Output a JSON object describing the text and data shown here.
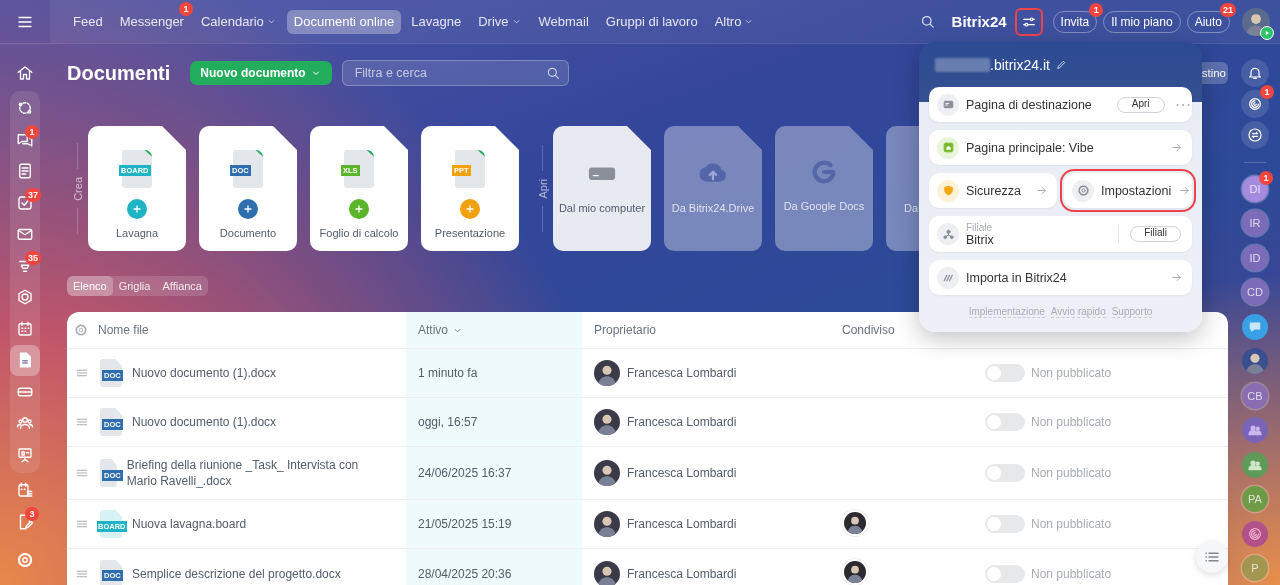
{
  "top_nav": {
    "menu_items": [
      {
        "label": "Feed",
        "selected": false,
        "dropdown": false
      },
      {
        "label": "Messenger",
        "selected": false,
        "dropdown": false,
        "badge": "1"
      },
      {
        "label": "Calendario",
        "selected": false,
        "dropdown": true
      },
      {
        "label": "Documenti online",
        "selected": true,
        "dropdown": false
      },
      {
        "label": "Lavagne",
        "selected": false,
        "dropdown": false
      },
      {
        "label": "Drive",
        "selected": false,
        "dropdown": true
      },
      {
        "label": "Webmail",
        "selected": false,
        "dropdown": false
      },
      {
        "label": "Gruppi di lavoro",
        "selected": false,
        "dropdown": false
      },
      {
        "label": "Altro",
        "selected": false,
        "dropdown": true
      }
    ],
    "logo": "Bitrix24",
    "settings_button": {
      "highlighted": true
    },
    "buttons": [
      {
        "label": "Invita",
        "badge": "1"
      },
      {
        "label": "Il mio piano"
      },
      {
        "label": "Aiuto",
        "badge": "21"
      }
    ]
  },
  "left_rail": {
    "items": [
      {
        "selected": false
      },
      {
        "selected": false
      },
      {
        "selected": false,
        "badge": "1"
      },
      {
        "selected": false
      },
      {
        "selected": false,
        "badge": "37"
      },
      {
        "selected": false
      },
      {
        "selected": false,
        "badge": "35"
      },
      {
        "selected": false
      },
      {
        "selected": false
      },
      {
        "selected": true
      },
      {
        "selected": false
      },
      {
        "selected": false
      },
      {
        "selected": false
      },
      {
        "selected": false
      },
      {
        "selected": false,
        "badge": "3"
      },
      {
        "selected": false
      }
    ]
  },
  "right_rail": {
    "items": [
      {
        "kind": "icon"
      },
      {
        "kind": "icon",
        "badge": "1"
      },
      {
        "kind": "icon"
      },
      {
        "kind": "initials",
        "initials": "DI",
        "badge": "1",
        "color": "#a58be0"
      },
      {
        "kind": "initials",
        "initials": "IR",
        "color": "#7b6bb8"
      },
      {
        "kind": "initials",
        "initials": "ID",
        "color": "#7b6bb8"
      },
      {
        "kind": "initials",
        "initials": "CD",
        "color": "#7b6bb8"
      },
      {
        "kind": "icon"
      },
      {
        "kind": "photo"
      },
      {
        "kind": "initials",
        "initials": "CB",
        "color": "#8a6cb0"
      },
      {
        "kind": "icon"
      },
      {
        "kind": "icon"
      },
      {
        "kind": "initials",
        "initials": "PA",
        "color": "#6f9a48"
      },
      {
        "kind": "icon"
      },
      {
        "kind": "initials",
        "initials": "P",
        "color": "#a39650"
      }
    ]
  },
  "page": {
    "title": "Documenti",
    "new_button": "Nuovo documento",
    "search": {
      "placeholder": "Filtra e cerca"
    },
    "partial_button": "stino"
  },
  "create": {
    "label": "Crea",
    "cards": [
      {
        "label": "Lavagna",
        "tag": "BOARD",
        "color": "#1fb3c4"
      },
      {
        "label": "Documento",
        "tag": "DOC",
        "color": "#2f6fb0"
      },
      {
        "label": "Foglio di calcolo",
        "tag": "XLS",
        "color": "#5ab52a"
      },
      {
        "label": "Presentazione",
        "tag": "PPT",
        "color": "#f0a10c"
      }
    ]
  },
  "open": {
    "label": "Apri",
    "cards": [
      {
        "label": "Dal mio computer",
        "kind": "computer"
      },
      {
        "label": "Da Bitrix24.Drive",
        "kind": "cloud"
      },
      {
        "label": "Da Google Docs",
        "kind": "google"
      },
      {
        "label": "Da",
        "kind": "partial"
      }
    ]
  },
  "view_switch": [
    {
      "label": "Elenco",
      "selected": true
    },
    {
      "label": "Griglia",
      "selected": false
    },
    {
      "label": "Affianca",
      "selected": false
    }
  ],
  "table": {
    "columns": [
      {
        "label": "Nome file",
        "sorted": false
      },
      {
        "label": "Attivo",
        "sorted": true
      },
      {
        "label": "Proprietario",
        "sorted": false
      },
      {
        "label": "Condiviso",
        "sorted": false
      }
    ],
    "rows": [
      {
        "name": "Nuovo documento (1).docx",
        "kind": "doc",
        "tag": "DOC",
        "active": "1 minuto fa",
        "owner": "Francesca Lombardi",
        "shared": false,
        "published": false,
        "status": "Non pubblicato"
      },
      {
        "name": "Nuovo documento (1).docx",
        "kind": "doc",
        "tag": "DOC",
        "active": "oggi, 16:57",
        "owner": "Francesca Lombardi",
        "shared": false,
        "published": false,
        "status": "Non pubblicato"
      },
      {
        "name": "Briefing della riunione _Task_ Intervista con Mario Ravelli_.docx",
        "kind": "doc",
        "tag": "DOC",
        "active": "24/06/2025 16:37",
        "owner": "Francesca Lombardi",
        "shared": false,
        "published": false,
        "status": "Non pubblicato"
      },
      {
        "name": "Nuova lavagna.board",
        "kind": "board",
        "tag": "BOARD",
        "active": "21/05/2025 15:19",
        "owner": "Francesca Lombardi",
        "shared": true,
        "published": false,
        "status": "Non pubblicato"
      },
      {
        "name": "Semplice descrizione del progetto.docx",
        "kind": "doc",
        "tag": "DOC",
        "active": "28/04/2025 20:36",
        "owner": "Francesca Lombardi",
        "shared": true,
        "published": false,
        "status": "Non pubblicato"
      }
    ]
  },
  "popup": {
    "domain": ".bitrix24.it",
    "tiles": [
      {
        "kind": "landing",
        "label": "Pagina di destinazione",
        "button": "Apri",
        "highlighted": false
      },
      {
        "kind": "vibe",
        "label": "Pagina principale: Vibe",
        "highlighted": false
      },
      {
        "kind": "security",
        "label": "Sicurezza",
        "highlighted": false
      },
      {
        "kind": "settings",
        "label": "Impostazioni",
        "highlighted": true
      },
      {
        "kind": "branch",
        "caption": "Filiale",
        "label": "Bitrix",
        "button": "Filiali",
        "highlighted": false
      },
      {
        "kind": "import",
        "label": "Importa in Bitrix24",
        "highlighted": false
      }
    ],
    "footer_links": [
      "Implementazione",
      "Avvio rapido",
      "Supporto"
    ]
  }
}
